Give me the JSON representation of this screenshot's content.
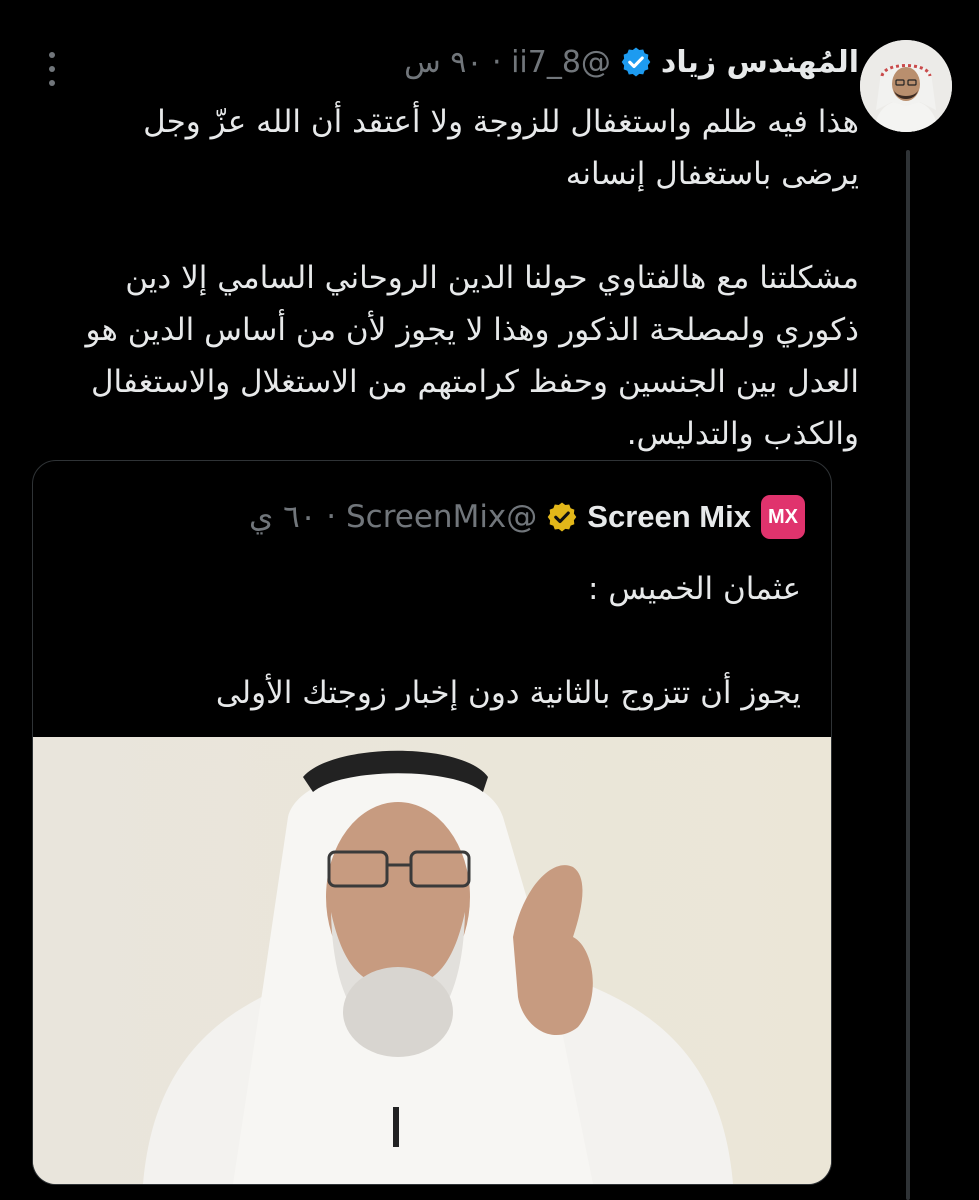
{
  "tweet": {
    "display_name": "المُهندس زياد",
    "handle": "@ii7_8",
    "time": "٩٠ س",
    "paragraphs": [
      "هذا فيه ظلم واستغفال للزوجة ولا أعتقد أن الله عزّ وجل يرضى باستغفال إنسانه",
      "مشكلتنا مع هالفتاوي حولنا الدين الروحاني السامي إلا دين ذكوري ولمصلحة الذكور وهذا لا يجوز لأن من أساس الدين هو العدل بين الجنسين وحفظ كرامتهم من الاستغلال والاستغفال والكذب والتدليس."
    ],
    "verified_icon": "blue-check-badge",
    "more_icon": "vertical-ellipsis"
  },
  "quote": {
    "logo_text": "MX",
    "display_name": "Screen Mix",
    "handle": "@ScreenMix",
    "time": "٦٠ ي",
    "verified_icon": "gold-check-badge",
    "lines": [
      "عثمان الخميس :",
      "يجوز أن تتزوج بالثانية دون إخبار زوجتك الأولى"
    ]
  },
  "colors": {
    "background": "#000000",
    "text": "#e7e9ea",
    "muted": "#71767b",
    "border": "#2f3336",
    "verified_blue": "#1d9bf0",
    "verified_gold": "#e2b719",
    "logo_pink": "#e0336d"
  }
}
